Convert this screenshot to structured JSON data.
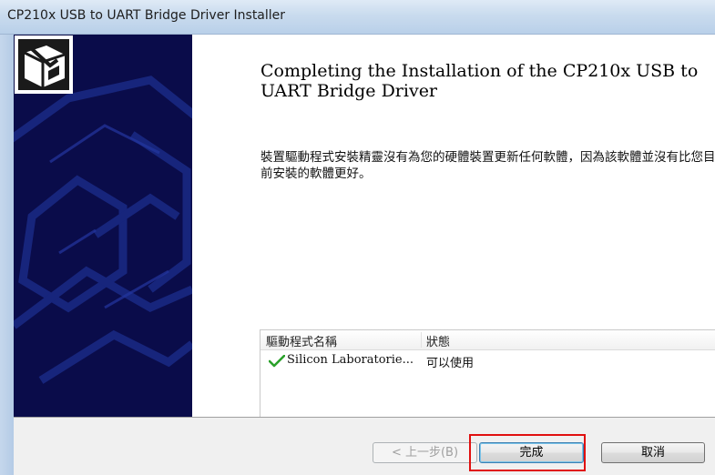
{
  "window": {
    "title": "CP210x USB to UART Bridge Driver Installer"
  },
  "page": {
    "heading": "Completing the Installation of the CP210x USB to UART Bridge Driver",
    "description": "裝置驅動程式安裝精靈沒有為您的硬體裝置更新任何軟體，因為該軟體並沒有比您目前安裝的軟體更好。"
  },
  "driver_list": {
    "columns": [
      "驅動程式名稱",
      "狀態"
    ],
    "rows": [
      {
        "name": "Silicon Laboratorie...",
        "status": "可以使用",
        "icon": "checkmark-icon"
      }
    ]
  },
  "buttons": {
    "back": "< 上一步(B)",
    "finish": "完成",
    "cancel": "取消"
  },
  "colors": {
    "banner": "#0a0c4a",
    "highlight": "#e01010",
    "check": "#2aa12a"
  }
}
